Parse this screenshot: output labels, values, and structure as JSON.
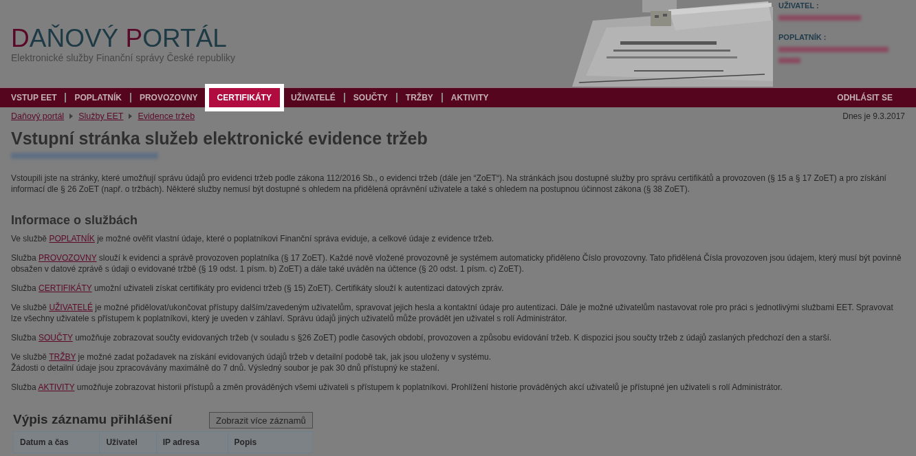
{
  "header": {
    "logo_parts": [
      {
        "text": "D",
        "accent": true
      },
      {
        "text": "AŇOVÝ ",
        "accent": false
      },
      {
        "text": "P",
        "accent": true
      },
      {
        "text": "ORTÁL",
        "accent": false
      }
    ],
    "subtitle": "Elektronické služby Finanční správy České republiky",
    "user_panel": [
      {
        "label": "UŽIVATEL :",
        "value": {
          "kind": "redacted"
        }
      },
      {
        "label": "POPLATNÍK :",
        "value": {
          "kind": "redacted"
        }
      }
    ]
  },
  "nav": {
    "items": [
      {
        "label": "VSTUP EET",
        "selected": false
      },
      {
        "label": "POPLATNÍK",
        "selected": false
      },
      {
        "label": "PROVOZOVNY",
        "selected": false
      },
      {
        "label": "CERTIFIKÁTY",
        "selected": true
      },
      {
        "label": "UŽIVATELÉ",
        "selected": false
      },
      {
        "label": "SOUČTY",
        "selected": false
      },
      {
        "label": "TRŽBY",
        "selected": false
      },
      {
        "label": "AKTIVITY",
        "selected": false
      }
    ],
    "logout": "ODHLÁSIT SE"
  },
  "breadcrumb": [
    "Daňový portál",
    "Služby EET",
    "Evidence tržeb"
  ],
  "date": "Dnes je 9.3.2017",
  "title": "Vstupní stránka služeb elektronické evidence tržeb",
  "subject": {
    "kind": "redacted"
  },
  "intro": "Vstoupili jste na stránky, které umožňují správu údajů pro evidenci tržeb podle zákona 112/2016 Sb., o evidenci tržeb (dále jen “ZoET“). Na stránkách jsou dostupné služby pro správu certifikátů a provozoven (§ 15 a § 17 ZoET) a pro získání informací dle § 26 ZoET (např. o tržbách). Některé služby nemusí být dostupné s ohledem na přidělená oprávnění uživatele a také s ohledem na postupnou účinnost zákona (§ 38 ZoET).",
  "services": {
    "heading": "Informace o službách",
    "paragraphs": [
      {
        "before": "Ve službě ",
        "link": "POPLATNÍK",
        "after": " je možné ověřit vlastní údaje, které o poplatníkovi Finanční správa eviduje, a celkové údaje z evidence tržeb."
      },
      {
        "before": "Služba ",
        "link": "PROVOZOVNY",
        "after": " slouží k evidenci a správě provozoven poplatníka (§ 17 ZoET). Každé nově vložené provozovně je systémem automaticky přiděleno Číslo provozovny. Tato přidělená Čísla provozoven jsou údajem, který musí být povinně obsažen v datové zprávě s údaji o evidované tržbě (§ 19 odst. 1 písm. b) ZoET) a dále také uváděn na účtence (§ 20 odst. 1 písm. c) ZoET)."
      },
      {
        "before": "Služba ",
        "link": "CERTIFIKÁTY",
        "after": " umožní uživateli získat certifikáty pro evidenci tržeb (§ 15) ZoET). Certifikáty slouží k autentizaci datových zpráv."
      },
      {
        "before": "Ve službě ",
        "link": "UŽIVATELÉ",
        "after": " je možné přidělovat/ukončovat přístupy dalším/zavedeným uživatelům, spravovat jejich hesla a kontaktní údaje pro autentizaci. Dále je možné uživatelům nastavovat role pro práci s jednotlivými službami EET. Spravovat lze všechny uživatele s přístupem k poplatníkovi, který je uveden v záhlaví. Správu údajů jiných uživatelů může provádět jen uživatel s rolí Administrátor."
      },
      {
        "before": "Služba ",
        "link": "SOUČTY",
        "after": " umožňuje zobrazovat součty evidovaných tržeb (v souladu s §26 ZoET) podle časových období, provozoven a způsobu evidování tržeb. K dispozici jsou součty tržeb z údajů zaslaných předchozí den a starší."
      },
      {
        "before": "Ve službě ",
        "link": "TRŽBY",
        "after": " je možné zadat požadavek na získání evidovaných údajů tržeb v detailní podobě tak, jak jsou uloženy v systému.\nŽádosti o detailní údaje jsou zpracovávány maximálně do 7 dnů. Výsledný soubor je pak 30 dnů přístupný ke stažení."
      },
      {
        "before": "Služba ",
        "link": "AKTIVITY",
        "after": " umožňuje zobrazovat historii přístupů a změn prováděných všemi uživateli s přístupem k poplatníkovi. Prohlížení historie prováděných akcí uživatelů je přístupné jen uživateli s rolí Administrátor."
      }
    ]
  },
  "login_log": {
    "heading": "Výpis záznamu přihlášení",
    "button": "Zobrazit více záznamů",
    "columns": [
      "Datum a čas",
      "Uživatel",
      "IP adresa",
      "Popis"
    ]
  }
}
